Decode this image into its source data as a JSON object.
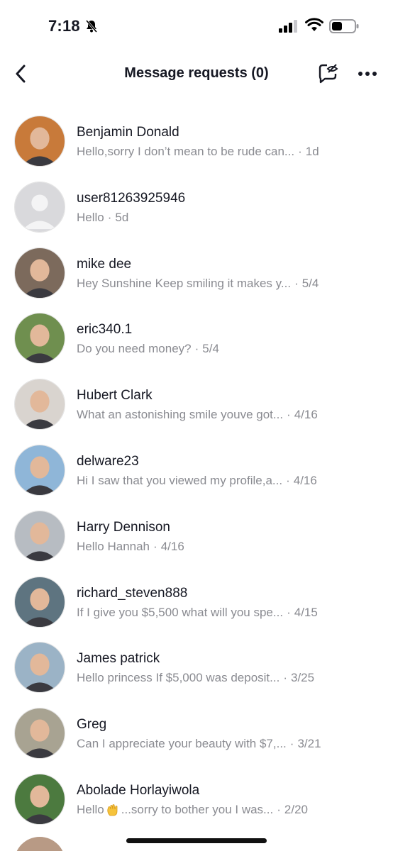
{
  "status_bar": {
    "time": "7:18",
    "icons": [
      "bell-slash-icon",
      "signal-icon",
      "wifi-icon",
      "battery-icon"
    ]
  },
  "header": {
    "title": "Message requests (0)",
    "back_icon": "chevron-left-icon",
    "hide_icon": "chat-bubble-eye-slash-icon",
    "more_icon": "ellipsis-icon"
  },
  "requests": [
    {
      "name": "Benjamin Donald",
      "message": "Hello,sorry I don’t mean to be rude can...",
      "time": "1d",
      "avatar_color": "#c87a3a"
    },
    {
      "name": "user81263925946",
      "message": "Hello",
      "time": "5d",
      "avatar_color": "#d9d9dc"
    },
    {
      "name": "mike dee",
      "message": "Hey Sunshine Keep smiling it makes y...",
      "time": "5/4",
      "avatar_color": "#7c6a5c"
    },
    {
      "name": "eric340.1",
      "message": "Do you need money?",
      "time": "5/4",
      "avatar_color": "#6f8f4f"
    },
    {
      "name": "Hubert Clark",
      "message": "What an astonishing smile youve got...",
      "time": "4/16",
      "avatar_color": "#d9d4cf"
    },
    {
      "name": "delware23",
      "message": "Hi I saw that you viewed my profile,a...",
      "time": "4/16",
      "avatar_color": "#8fb6d8"
    },
    {
      "name": "Harry Dennison",
      "message": "Hello Hannah",
      "time": "4/16",
      "avatar_color": "#b7bcc2"
    },
    {
      "name": "richard_steven888",
      "message": "If I give you $5,500 what will you spe...",
      "time": "4/15",
      "avatar_color": "#5e7480"
    },
    {
      "name": "James patrick",
      "message": "Hello princess If $5,000 was deposit...",
      "time": "3/25",
      "avatar_color": "#9bb3c6"
    },
    {
      "name": "Greg",
      "message": "Can I appreciate your beauty with $7,...",
      "time": "3/21",
      "avatar_color": "#a8a392"
    },
    {
      "name": "Abolade Horlayiwola",
      "message_prefix": "Hello",
      "message_emoji": "waving-hand-emoji",
      "message": "...sorry to bother you I was...",
      "time": "2/20",
      "avatar_color": "#4c7a3f"
    }
  ]
}
